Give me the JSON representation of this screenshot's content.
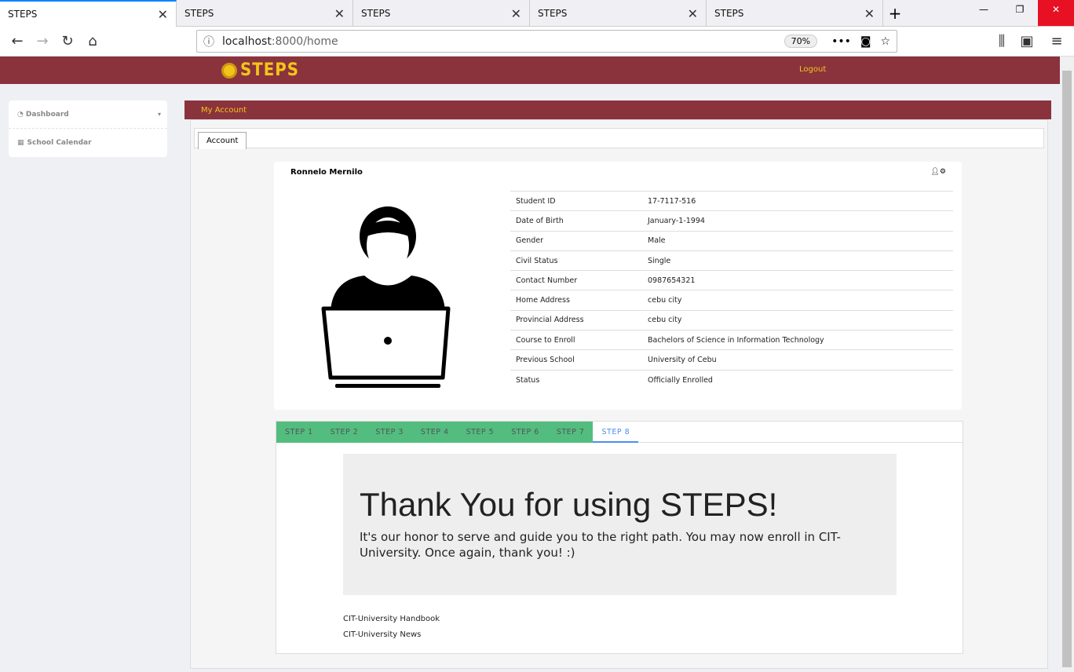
{
  "browser": {
    "tabs": [
      "STEPS",
      "STEPS",
      "STEPS",
      "STEPS",
      "STEPS"
    ],
    "url_host": "localhost",
    "url_path": ":8000/home",
    "zoom": "70%"
  },
  "header": {
    "logo": "STEPS",
    "logout": "Logout"
  },
  "sidebar": {
    "items": [
      {
        "label": "Dashboard",
        "icon": "dashboard-icon"
      },
      {
        "label": "School Calendar",
        "icon": "calendar-icon"
      }
    ]
  },
  "panel": {
    "title": "My Account",
    "tab": "Account"
  },
  "profile": {
    "name": "Ronnelo Mernilo",
    "rows": [
      [
        "Student ID",
        "17-7117-516"
      ],
      [
        "Date of Birth",
        "January-1-1994"
      ],
      [
        "Gender",
        "Male"
      ],
      [
        "Civil Status",
        "Single"
      ],
      [
        "Contact Number",
        "0987654321"
      ],
      [
        "Home Address",
        "cebu city"
      ],
      [
        "Provincial Address",
        "cebu city"
      ],
      [
        "Course to Enroll",
        "Bachelors of Science in Information Technology"
      ],
      [
        "Previous School",
        "University of Cebu"
      ],
      [
        "Status",
        "Officially Enrolled"
      ]
    ]
  },
  "steps": {
    "items": [
      "STEP 1",
      "STEP 2",
      "STEP 3",
      "STEP 4",
      "STEP 5",
      "STEP 6",
      "STEP 7",
      "STEP 8"
    ],
    "active": "STEP 8",
    "done_color": "#52bd7e",
    "active_color": "#4a8ff0"
  },
  "message": {
    "title": "Thank You for using STEPS!",
    "body": "It's our honor to serve and guide you to the right path. You may now enroll in CIT-University. Once again, thank you! :)"
  },
  "links": [
    "CIT-University Handbook",
    "CIT-University News"
  ]
}
